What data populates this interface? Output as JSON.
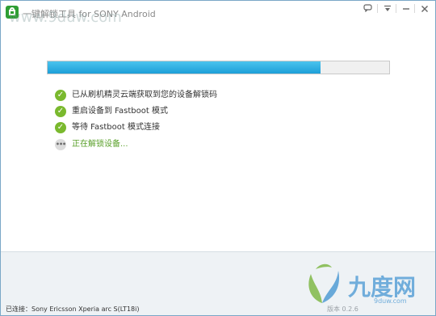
{
  "window": {
    "title_prefix": "一键解锁工具",
    "title_brand": "for SONY Android",
    "controls": {
      "feedback_icon": "speech-bubble-icon",
      "menu_icon": "chevron-down-icon",
      "minimize_icon": "minimize-icon",
      "close_icon": "close-icon"
    }
  },
  "progress": {
    "value": 0.8
  },
  "steps": [
    {
      "label": "已从刷机精灵云端获取到您的设备解锁码",
      "status": "done"
    },
    {
      "label": "重启设备到 Fastboot 模式",
      "status": "done"
    },
    {
      "label": "等待 Fastboot 模式连接",
      "status": "done"
    },
    {
      "label": "正在解锁设备...",
      "status": "in-progress"
    }
  ],
  "statusbar": {
    "connection": "已连接：Sony Ericsson Xperia arc S(LT18i)",
    "version": "版本 0.2.6"
  },
  "watermark": {
    "top": "www.9duw.com",
    "logo_text": "九度网",
    "url": "9duw.com"
  },
  "colors": {
    "accent": "#1d9fd8",
    "success": "#7ab92e",
    "active_text": "#5aa02a",
    "app_icon": "#2f9e33"
  }
}
